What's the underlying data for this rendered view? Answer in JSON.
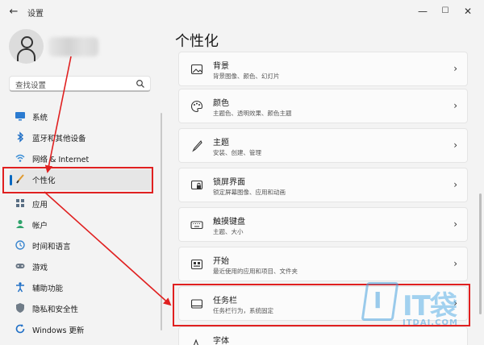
{
  "window": {
    "title": "设置",
    "back_glyph": "←",
    "minimize_glyph": "—",
    "maximize_glyph": "☐",
    "close_glyph": "✕"
  },
  "search": {
    "placeholder": "查找设置"
  },
  "sidebar": {
    "items": [
      {
        "label": "系统",
        "icon": "monitor-icon",
        "active": false
      },
      {
        "label": "蓝牙和其他设备",
        "icon": "bluetooth-icon",
        "active": false
      },
      {
        "label": "网络 & Internet",
        "icon": "network-icon",
        "active": false
      },
      {
        "label": "个性化",
        "icon": "brush-icon",
        "active": true
      },
      {
        "label": "应用",
        "icon": "apps-icon",
        "active": false
      },
      {
        "label": "帐户",
        "icon": "account-icon",
        "active": false
      },
      {
        "label": "时间和语言",
        "icon": "globe-clock-icon",
        "active": false
      },
      {
        "label": "游戏",
        "icon": "gamepad-icon",
        "active": false
      },
      {
        "label": "辅助功能",
        "icon": "accessibility-icon",
        "active": false
      },
      {
        "label": "隐私和安全性",
        "icon": "shield-icon",
        "active": false
      },
      {
        "label": "Windows 更新",
        "icon": "update-icon",
        "active": false
      }
    ]
  },
  "main": {
    "title": "个性化",
    "cards": [
      {
        "title": "背景",
        "desc": "背景图像、颜色、幻灯片",
        "icon": "image-icon"
      },
      {
        "title": "颜色",
        "desc": "主题色、透明效果、颜色主题",
        "icon": "palette-icon"
      },
      {
        "title": "主题",
        "desc": "安装、创建、管理",
        "icon": "pen-icon"
      },
      {
        "title": "锁屏界面",
        "desc": "锁定屏幕图像、应用和动画",
        "icon": "lockscreen-icon"
      },
      {
        "title": "触摸键盘",
        "desc": "主题、大小",
        "icon": "keyboard-icon"
      },
      {
        "title": "开始",
        "desc": "最近使用的应用和项目、文件夹",
        "icon": "start-icon"
      },
      {
        "title": "任务栏",
        "desc": "任务栏行为，系统固定",
        "icon": "taskbar-icon"
      },
      {
        "title": "字体",
        "desc": "",
        "icon": "font-icon"
      }
    ],
    "chevron": "›"
  },
  "watermark": {
    "logo_letter": "I",
    "big_text": "IT袋",
    "small_text": "ITDAI.COM"
  },
  "colors": {
    "accent": "#0067c0",
    "highlight": "#e02020",
    "page_bg": "#f3f3f3",
    "card_bg": "#fbfbfb"
  }
}
